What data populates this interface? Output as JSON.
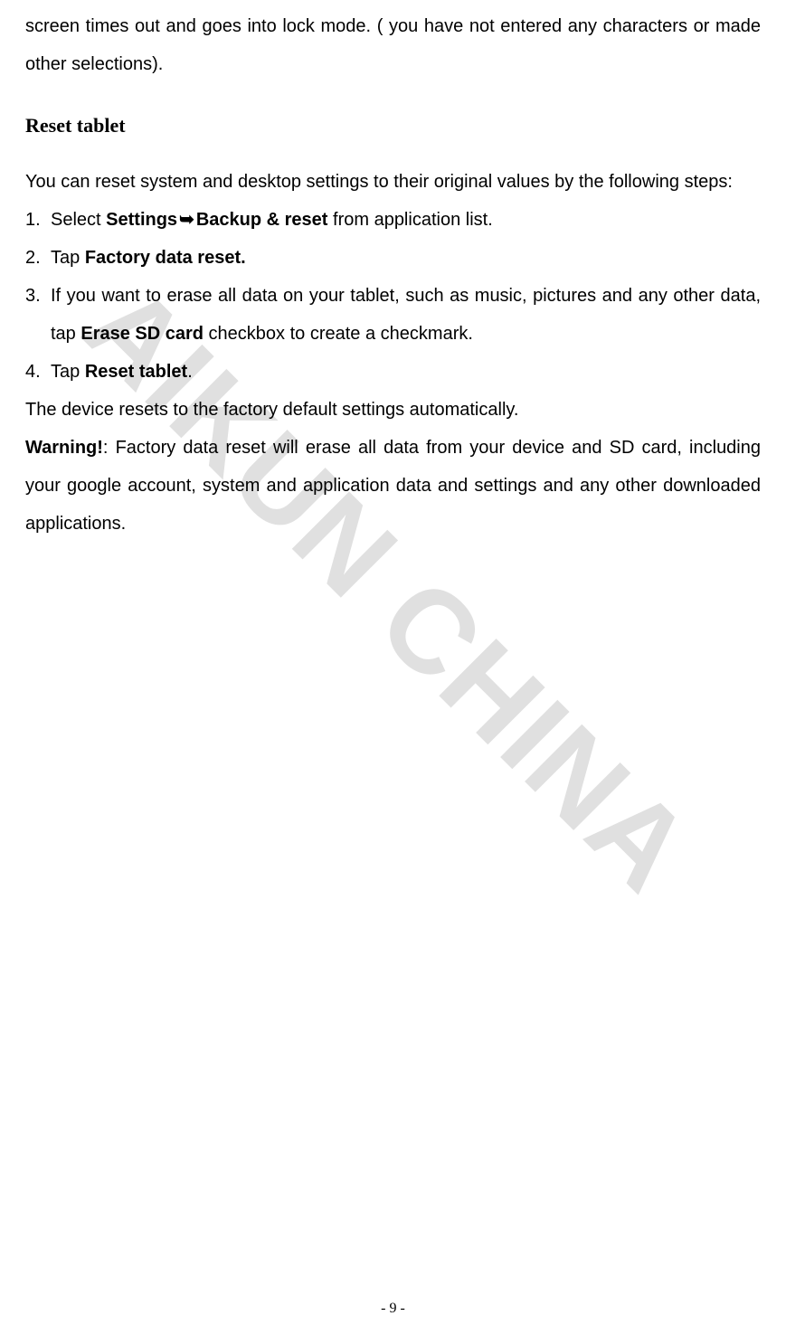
{
  "watermark": "AIKUN CHINA",
  "topFragment": "screen times out and goes into lock mode. ( you have not entered any characters or made other selections).",
  "heading": "Reset tablet",
  "intro": "You can reset system and desktop settings to their original values by the following steps:",
  "steps": [
    {
      "pre": "Select ",
      "b1": "Settings",
      "arrow": "➥",
      "b2": "Backup & reset",
      "post": " from application list."
    },
    {
      "pre": "Tap ",
      "b1": "Factory data reset.",
      "post": ""
    },
    {
      "pre": "If you want to erase all data on your tablet, such as music, pictures and any other data, tap ",
      "b1": "Erase SD card",
      "post": " checkbox to create a checkmark."
    },
    {
      "pre": "Tap ",
      "b1": "Reset tablet",
      "post": "."
    }
  ],
  "after": "The device resets to the factory default settings automatically.",
  "warningLabel": "Warning!",
  "warningText": ": Factory data reset will erase all data from your device and SD card, including your google account, system and application data and settings and any other downloaded applications.",
  "pageNumber": "- 9 -"
}
